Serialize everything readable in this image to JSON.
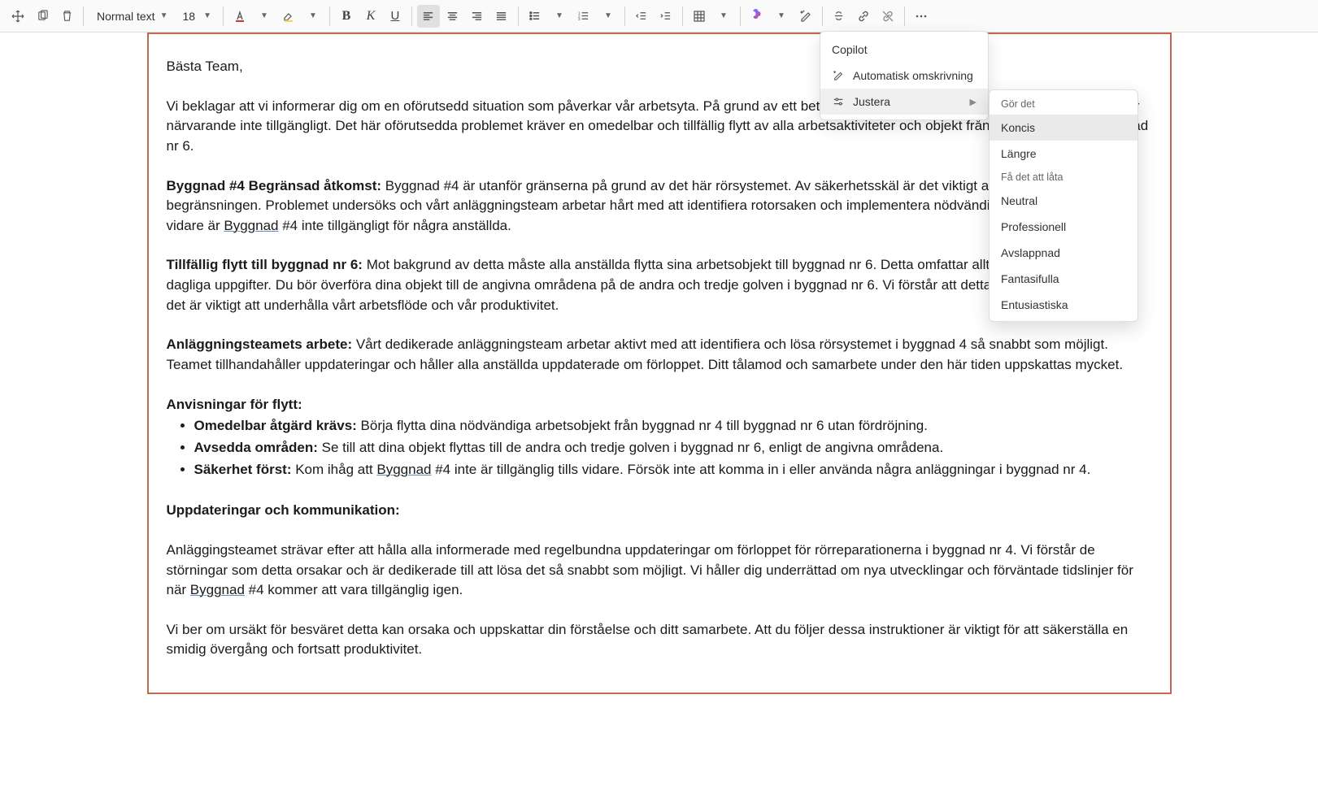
{
  "toolbar": {
    "style_label": "Normal text",
    "font_size": "18",
    "bold": "B",
    "italic": "K",
    "underline": "U"
  },
  "copilot_menu": {
    "title": "Copilot",
    "auto_rewrite": "Automatisk omskrivning",
    "adjust": "Justera"
  },
  "adjust_menu": {
    "header1": "Gör det",
    "concise": "Koncis",
    "longer": "Längre",
    "header2": "Få det att låta",
    "neutral": "Neutral",
    "professional": "Professionell",
    "casual": "Avslappnad",
    "fantastic": "Fantasifulla",
    "enthusiastic": "Entusiastiska"
  },
  "doc": {
    "greeting": "Bästa Team,",
    "p1a": "Vi beklagar att vi informerar dig om en oförutsedd situation som påverkar vår arbetsyta. På grund av ett betydande problem med rörsystemet är ",
    "link1": "Byggnad",
    "p1b": " #4 för närvarande inte tillgängligt. Det här oförutsedda problemet kräver en omedelbar och tillfällig flytt av alla arbetsaktiviteter och objekt från byggnad nr 4 till byggnad nr 6.",
    "h1": "Byggnad #4 Begränsad åtkomst: ",
    "p2a": "Byggnad #4 är utanför gränserna på grund av det här rörsystemet. Av säkerhetsskäl är det viktigt att alla följer den här begränsningen. Problemet undersöks och vårt anläggningsteam arbetar hårt med att identifiera rotorsaken och implementera nödvändiga reparationer. Tills vidare är ",
    "link2": "Byggnad",
    "p2b": " #4 inte tillgängligt för några anställda.",
    "h2": "Tillfällig flytt till byggnad nr 6: ",
    "p3": "Mot bakgrund av detta måste alla anställda flytta sina arbetsobjekt till byggnad nr 6. Detta omfattar allt du behöver för dina dagliga uppgifter. Du bör överföra dina objekt till de angivna områdena på de andra och tredje golven i byggnad nr 6. Vi förstår att detta är en olägenheter, men det är viktigt att underhålla vårt arbetsflöde och vår produktivitet.",
    "h3": "Anläggningsteamets arbete: ",
    "p4": "Vårt dedikerade anläggningsteam arbetar aktivt med att identifiera och lösa rörsystemet i byggnad 4 så snabbt som möjligt. Teamet tillhandahåller uppdateringar och håller alla anställda uppdaterade om förloppet. Ditt tålamod och samarbete under den här tiden uppskattas mycket.",
    "h4": "Anvisningar för flytt:",
    "b1s": "Omedelbar åtgärd krävs: ",
    "b1": "Börja flytta dina nödvändiga arbetsobjekt från byggnad nr 4 till byggnad nr 6 utan fördröjning.",
    "b2s": "Avsedda områden: ",
    "b2": "Se till att dina objekt flyttas till de andra och tredje golven i byggnad nr 6, enligt de angivna områdena.",
    "b3s": "Säkerhet först: ",
    "b3a": "Kom ihåg att ",
    "link3": "Byggnad",
    "b3b": " #4 inte är tillgänglig tills vidare. Försök inte att komma in i eller använda några anläggningar i byggnad nr 4.",
    "h5": "Uppdateringar och kommunikation:",
    "p5a": "Anläggingsteamet strävar efter att hålla alla informerade med regelbundna uppdateringar om förloppet för rörreparationerna i byggnad nr 4. Vi förstår de störningar som detta orsakar och är dedikerade till att lösa det så snabbt som möjligt. Vi håller dig underrättad om nya utvecklingar och förväntade tidslinjer för när ",
    "link4": "Byggnad",
    "p5b": " #4 kommer att vara tillgänglig igen.",
    "p6": "Vi ber om ursäkt för besväret detta kan orsaka och uppskattar din förståelse och ditt samarbete. Att du följer dessa instruktioner är viktigt för att säkerställa en smidig övergång och fortsatt produktivitet."
  }
}
